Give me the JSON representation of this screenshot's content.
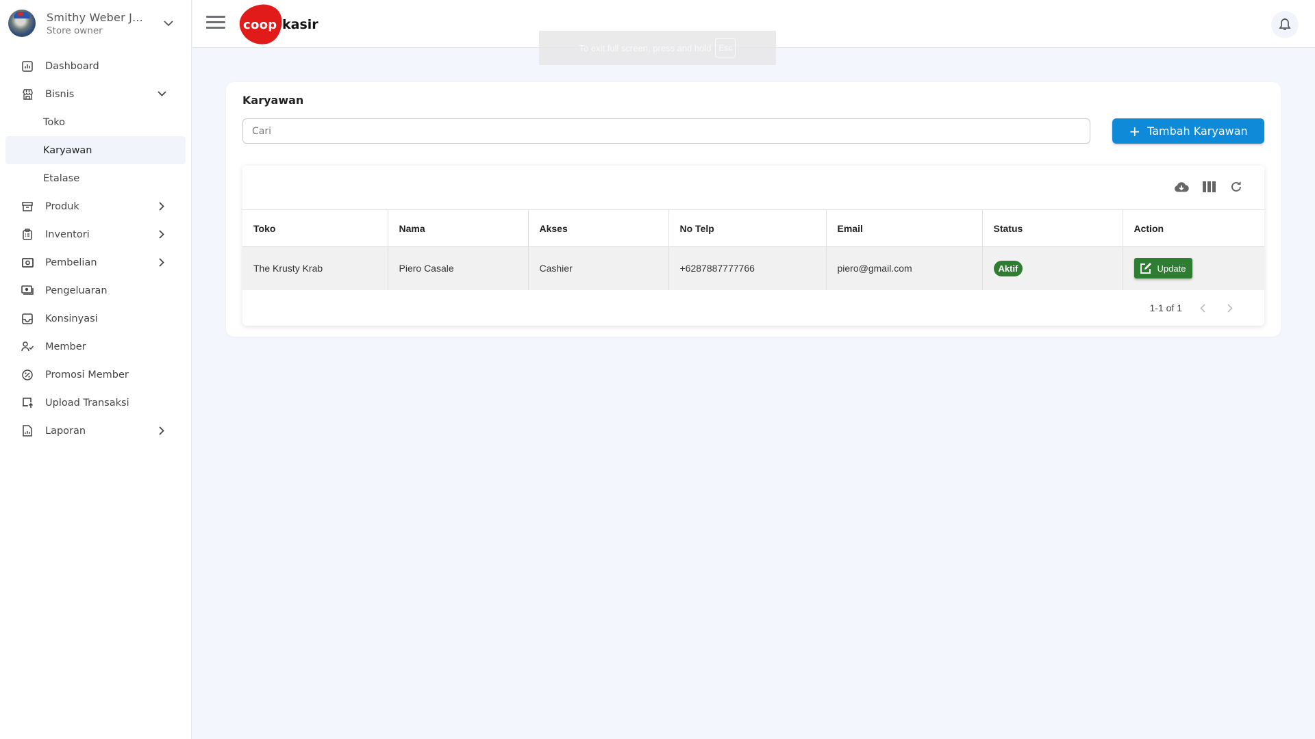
{
  "user": {
    "name": "Smithy Weber J...",
    "role": "Store owner"
  },
  "sidebar": {
    "items": [
      {
        "label": "Dashboard",
        "icon": "dashboard-icon"
      },
      {
        "label": "Bisnis",
        "icon": "store-icon",
        "expanded": true,
        "children": [
          {
            "label": "Toko"
          },
          {
            "label": "Karyawan",
            "active": true
          },
          {
            "label": "Etalase"
          }
        ]
      },
      {
        "label": "Produk",
        "icon": "archive-icon"
      },
      {
        "label": "Inventori",
        "icon": "clipboard-icon"
      },
      {
        "label": "Pembelian",
        "icon": "cash-icon"
      },
      {
        "label": "Pengeluaran",
        "icon": "payments-icon"
      },
      {
        "label": "Konsinyasi",
        "icon": "inbox-icon"
      },
      {
        "label": "Member",
        "icon": "user-check-icon"
      },
      {
        "label": "Promosi Member",
        "icon": "discount-icon"
      },
      {
        "label": "Upload Transaksi",
        "icon": "upload-icon"
      },
      {
        "label": "Laporan",
        "icon": "report-icon"
      }
    ]
  },
  "header": {
    "logo_left": "coop",
    "logo_right": "kasir",
    "fullscreen_notice": "To exit full screen, press and hold",
    "fullscreen_key": "Esc"
  },
  "page": {
    "title": "Karyawan",
    "search_placeholder": "Cari",
    "search_value": "",
    "add_button": "Tambah Karyawan"
  },
  "table": {
    "columns": [
      "Toko",
      "Nama",
      "Akses",
      "No Telp",
      "Email",
      "Status",
      "Action"
    ],
    "rows": [
      {
        "toko": "The Krusty Krab",
        "nama": "Piero Casale",
        "akses": "Cashier",
        "no_telp": "+6287887777766",
        "email": "piero@gmail.com",
        "status": "Aktif",
        "action": "Update"
      }
    ],
    "pagination": "1-1 of 1"
  },
  "colors": {
    "primary": "#0e8ad9",
    "success": "#2e7d32",
    "logo_red": "#e11a1a",
    "background": "#f3f6fc"
  }
}
